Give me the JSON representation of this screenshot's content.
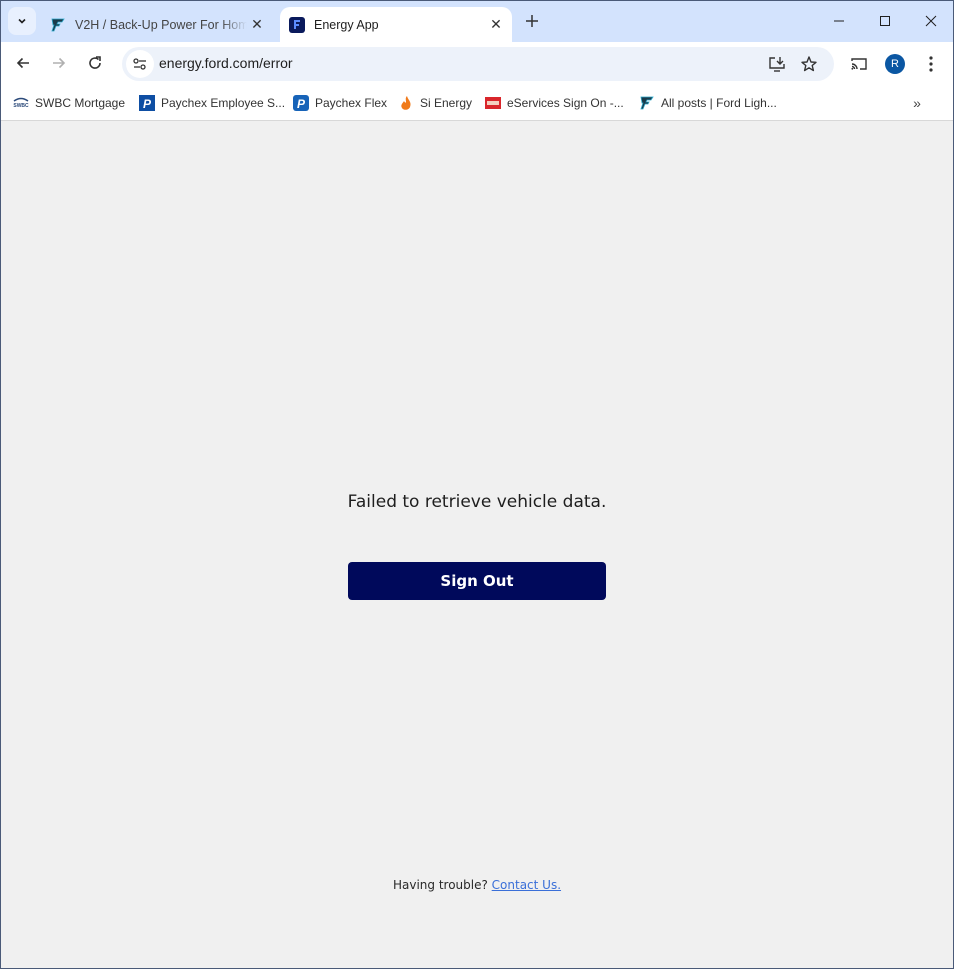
{
  "browser": {
    "tab_search_icon": "chevron-down-icon",
    "tabs": [
      {
        "title": "V2H / Back-Up Power For Home",
        "favicon": "ford-lightning-icon",
        "active": false
      },
      {
        "title": "Energy App",
        "favicon": "ford-energy-icon",
        "active": true
      }
    ],
    "new_tab_icon": "plus-icon",
    "window_controls": [
      "minimize-icon",
      "maximize-icon",
      "close-icon"
    ],
    "address_bar": {
      "url": "energy.ford.com/error"
    },
    "profile_initial": "R",
    "colors": {
      "tabstrip": "#d3e3fd",
      "omnibox": "#edf2fa",
      "avatar": "#0b57a3"
    }
  },
  "bookmarks": [
    {
      "label": "SWBC Mortgage",
      "icon": "swbc-icon"
    },
    {
      "label": "Paychex Employee S...",
      "icon": "paychex-icon"
    },
    {
      "label": "Paychex Flex",
      "icon": "paychex-flex-icon"
    },
    {
      "label": "Si Energy",
      "icon": "flame-icon"
    },
    {
      "label": "eServices Sign On -...",
      "icon": "eservices-icon"
    },
    {
      "label": "All posts | Ford Ligh...",
      "icon": "ford-lightning-icon"
    }
  ],
  "page": {
    "error_message": "Failed to retrieve vehicle data.",
    "sign_out_label": "Sign Out",
    "trouble_text": "Having trouble?",
    "contact_link": "Contact Us.",
    "colors": {
      "button": "#00095b",
      "background": "#f0f0f0",
      "link": "#3a6fd8"
    }
  }
}
